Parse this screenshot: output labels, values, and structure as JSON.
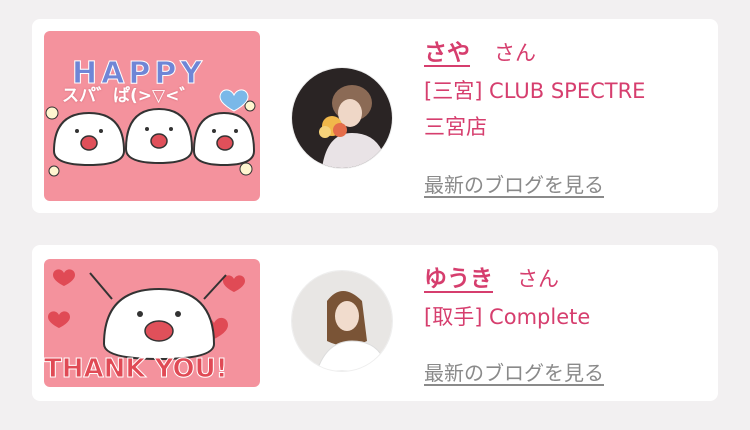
{
  "colors": {
    "background": "#f2f0f1",
    "card": "#ffffff",
    "accent": "#d63e6e",
    "link_muted": "#8a8a8a",
    "sticker_pink": "#f4929d"
  },
  "entries": [
    {
      "name": "さや",
      "honorific": "さん",
      "shop_line1": "[三宮] CLUB SPECTRE",
      "shop_line2": "三宮店",
      "blog_link": "最新のブログを見る",
      "sticker": {
        "headline": "HAPPY",
        "caption": "スパ゛ぱ(>▽<゛",
        "icon": "happy-characters-sticker"
      },
      "avatar_icon": "profile-photo"
    },
    {
      "name": "ゆうき",
      "honorific": "さん",
      "shop_line1": "[取手] Complete",
      "blog_link": "最新のブログを見る",
      "sticker": {
        "headline": "THANK YOU!",
        "icon": "thank-you-character-sticker"
      },
      "avatar_icon": "profile-photo"
    }
  ]
}
